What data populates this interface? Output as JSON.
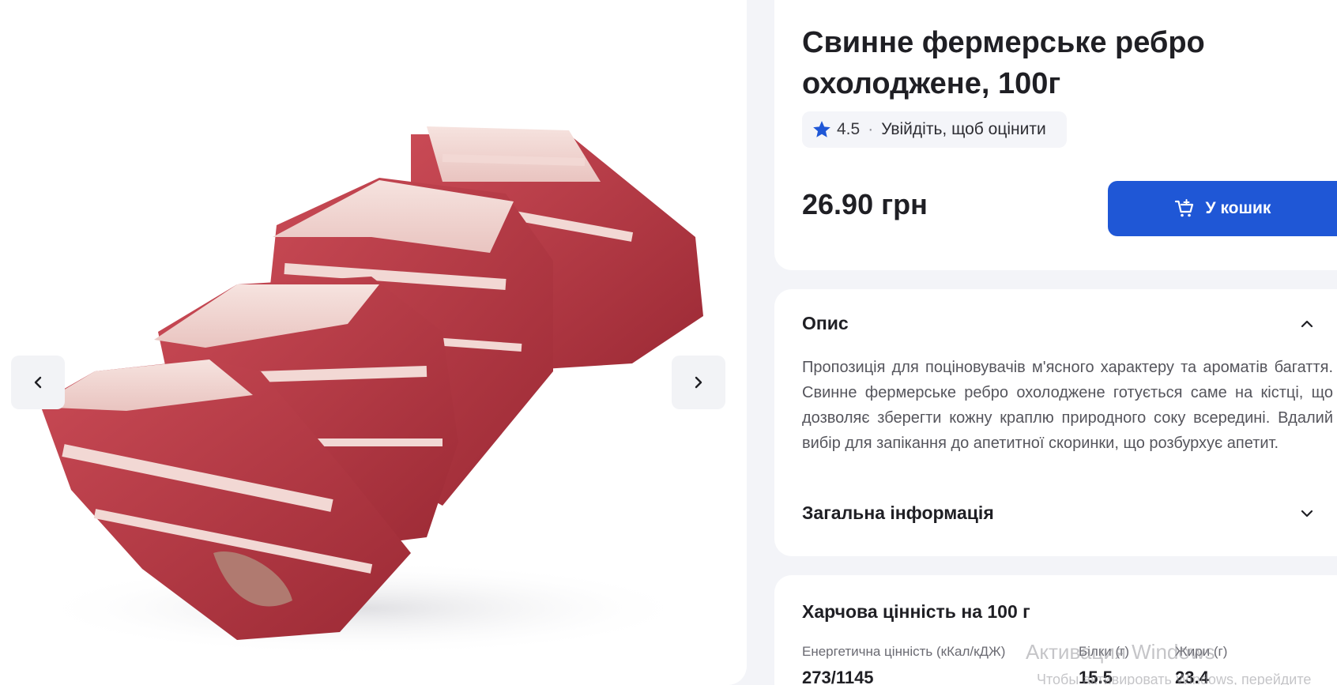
{
  "gallery": {
    "image_alt": "Свинне фермерське ребро охолоджене",
    "prev_icon": "chevron-left-icon",
    "next_icon": "chevron-right-icon"
  },
  "product": {
    "title": "Свинне фермерське ребро охолоджене, 100г",
    "rating": {
      "icon": "star-icon",
      "value": "4.5",
      "separator": "·",
      "login_prompt": "Увійдіть, щоб оцінити"
    },
    "price": "26.90 грн",
    "cart_button": {
      "icon": "cart-add-icon",
      "label": "У кошик"
    }
  },
  "description": {
    "heading": "Опис",
    "text": "Пропозиція для поціновувачів м'ясного характеру та ароматів багаття. Свинне фермерське ребро охолоджене готується саме на кістці, що дозволяє зберегти кожну краплю природного соку всередині. Вдалий вибір для запікання до апетитної скоринки, що розбурхує апетит.",
    "general_info_heading": "Загальна інформація"
  },
  "nutrition": {
    "heading": "Харчова цінність на 100 г",
    "columns": [
      {
        "label": "Енергетична цінність (кКал/кДЖ)",
        "value": "273/1145"
      },
      {
        "label": "Білки (г)",
        "value": "15.5"
      },
      {
        "label": "Жири (г)",
        "value": "23.4"
      }
    ]
  },
  "os_watermark": {
    "line1": "Активация Windows",
    "line2": "Чтобы активировать Windows, перейдите"
  },
  "colors": {
    "accent": "#1f57d6",
    "background": "#f3f4f8",
    "card": "#ffffff",
    "star": "#1f57d6"
  }
}
